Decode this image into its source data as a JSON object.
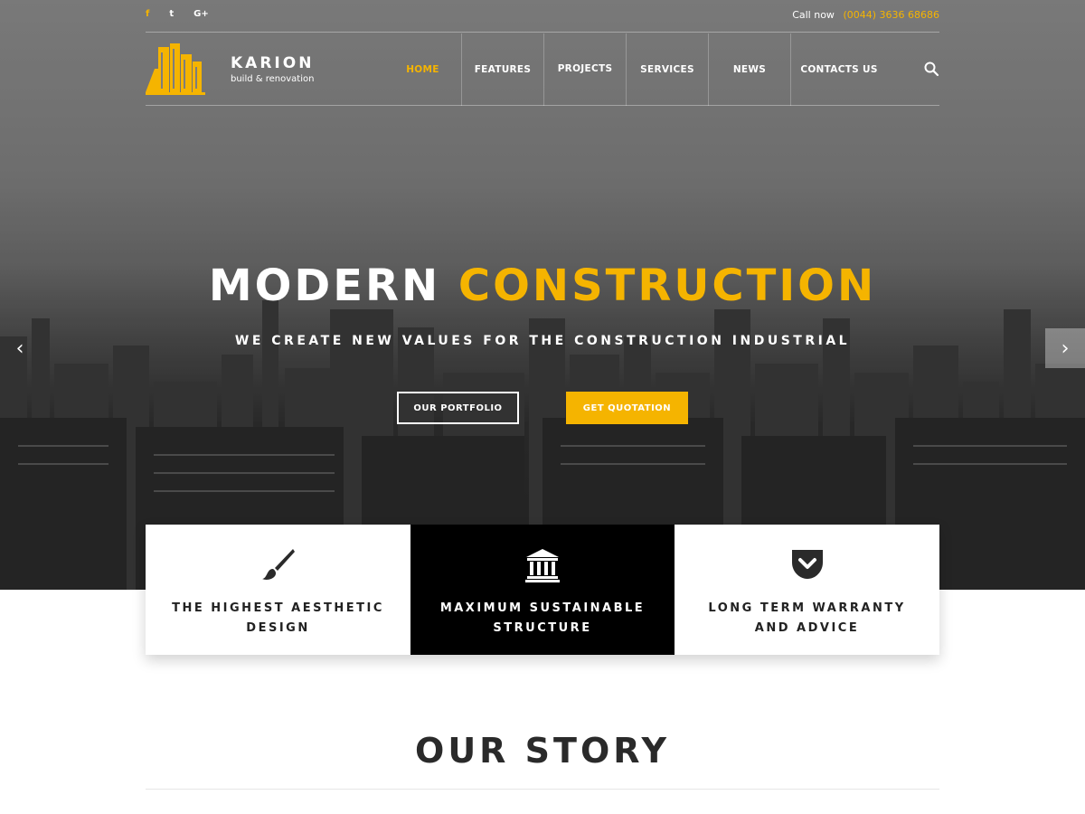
{
  "topbar": {
    "social": [
      "f",
      "t",
      "G+"
    ],
    "call_label": "Call now",
    "phone": "(0044) 3636 68686"
  },
  "header": {
    "brand": "KARION",
    "tagline": "build & renovation",
    "nav": [
      {
        "label": "HOME",
        "active": true
      },
      {
        "label": "FEATURES",
        "active": false
      },
      {
        "label": "PROJECTS",
        "active": false
      },
      {
        "label": "SERVICES",
        "active": false
      },
      {
        "label": "NEWS",
        "active": false
      },
      {
        "label": "CONTACTS US",
        "active": false
      }
    ],
    "search_icon": "search-icon"
  },
  "hero": {
    "title_main": "MODERN",
    "title_accent": "CONSTRUCTION",
    "subtitle": "WE CREATE NEW VALUES FOR THE CONSTRUCTION INDUSTRIAL",
    "btn_portfolio": "OUR PORTFOLIO",
    "btn_quote": "GET QUOTATION",
    "arrow_left": "‹",
    "arrow_right": "›"
  },
  "features": [
    {
      "icon": "paintbrush-icon",
      "line1": "THE HIGHEST AESTHETIC",
      "line2": "DESIGN"
    },
    {
      "icon": "institution-icon",
      "line1": "MAXIMUM SUSTAINABLE",
      "line2": "STRUCTURE"
    },
    {
      "icon": "pocket-icon",
      "line1": "LONG TERM WARRANTY",
      "line2": "AND ADVICE"
    }
  ],
  "story": {
    "title": "OUR STORY"
  },
  "colors": {
    "accent": "#f5b400",
    "dark": "#000000",
    "text": "#222222"
  }
}
